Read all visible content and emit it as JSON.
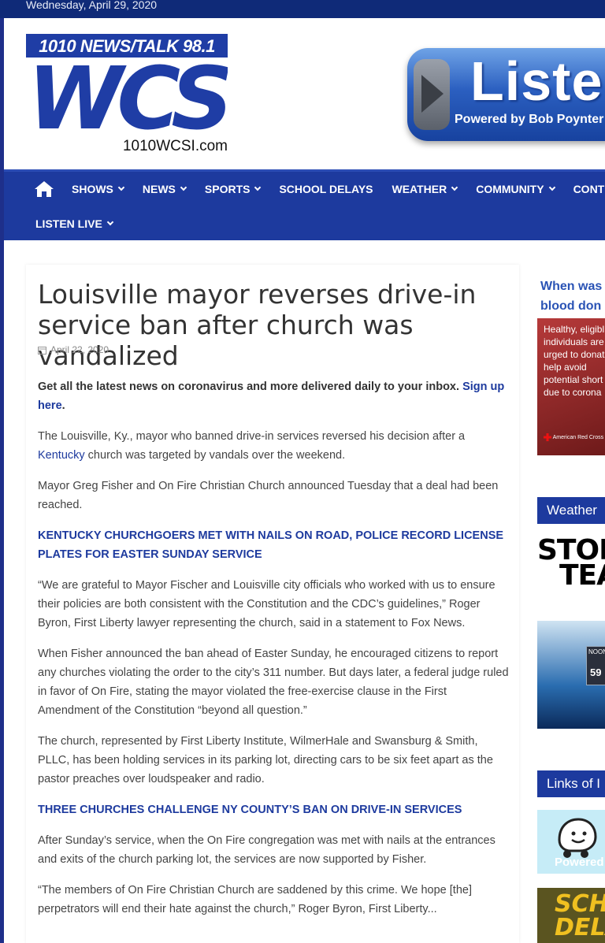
{
  "topbar": {
    "date": "Wednesday, April 29, 2020"
  },
  "logo": {
    "top": "1010   NEWS/TALK   98.1",
    "main": "WCSI",
    "url": "1010WCSI.com"
  },
  "listen_ad": {
    "word": "Listen",
    "sub": "Powered by Bob Poynter Fam"
  },
  "nav": {
    "items_row1": [
      {
        "label": "SHOWS",
        "caret": true
      },
      {
        "label": "NEWS",
        "caret": true
      },
      {
        "label": "SPORTS",
        "caret": true
      },
      {
        "label": "SCHOOL DELAYS",
        "caret": false
      },
      {
        "label": "WEATHER",
        "caret": true
      },
      {
        "label": "COMMUNITY",
        "caret": true
      },
      {
        "label": "CONTES",
        "caret": false
      }
    ],
    "items_row2": [
      {
        "label": "LISTEN LIVE",
        "caret": true
      }
    ]
  },
  "article": {
    "title": "Louisville mayor reverses drive-in service ban after church was vandalized",
    "date": "April 22, 2020",
    "signup_text": "Get all the latest news on coronavirus and more delivered daily to your inbox.",
    "signup_link": "Sign up here",
    "p1_before": "The Louisville, Ky., mayor who banned drive-in services reversed his decision after a ",
    "p1_link": "Kentucky",
    "p1_after": " church was targeted by vandals over the weekend.",
    "p2": "Mayor Greg Fisher and On Fire Christian Church announced Tuesday that a deal had been reached.",
    "h1": "KENTUCKY CHURCHGOERS MET WITH NAILS ON ROAD, POLICE RECORD LICENSE PLATES FOR EASTER SUNDAY SERVICE",
    "p3": "“We are grateful to Mayor Fischer and Louisville city officials who worked with us to ensure their policies are both consistent with the Constitution and the CDC’s guidelines,” Roger Byron, First Liberty lawyer representing the church, said in a statement to Fox News.",
    "p4": "When Fisher announced the ban ahead of Easter Sunday, he encouraged citizens to report any churches violating the order to the city’s 311 number. But days later, a federal judge ruled in favor of On Fire, stating the mayor violated the free-exercise clause in the First Amendment of the Constitution “beyond all question.”",
    "p5": "The church, represented by First Liberty Institute, WilmerHale and Swansburg & Smith, PLLC, has been holding services in its parking lot, directing cars to be six feet apart as the pastor preaches over loudspeaker and radio.",
    "h2": "THREE CHURCHES CHALLENGE NY COUNTY’S BAN ON DRIVE-IN SERVICES",
    "p6": "After Sunday’s service, when the On Fire congregation was met with nails at the entrances and exits of the church parking lot, the services are now supported by Fisher.",
    "p7": "“The members of On Fire Christian Church are saddened by this crime. We hope [the] perpetrators will end their hate against the church,” Roger Byron, First Liberty..."
  },
  "sidebar": {
    "blood_head": [
      "When was",
      "blood don"
    ],
    "blood_body": [
      "Healthy, eligibl",
      "individuals are",
      "urged to donat",
      "help avoid",
      "potential short",
      "due to corona"
    ],
    "red_cross": "American Red Cross",
    "weather_title": "Weather",
    "storm_lines": [
      "STOR",
      "TEA"
    ],
    "tv_readout": [
      "NOON",
      "59"
    ],
    "links_title": "Links of I",
    "waze_text": "Powered",
    "school_lines": [
      "SCHO",
      "DELA"
    ]
  }
}
